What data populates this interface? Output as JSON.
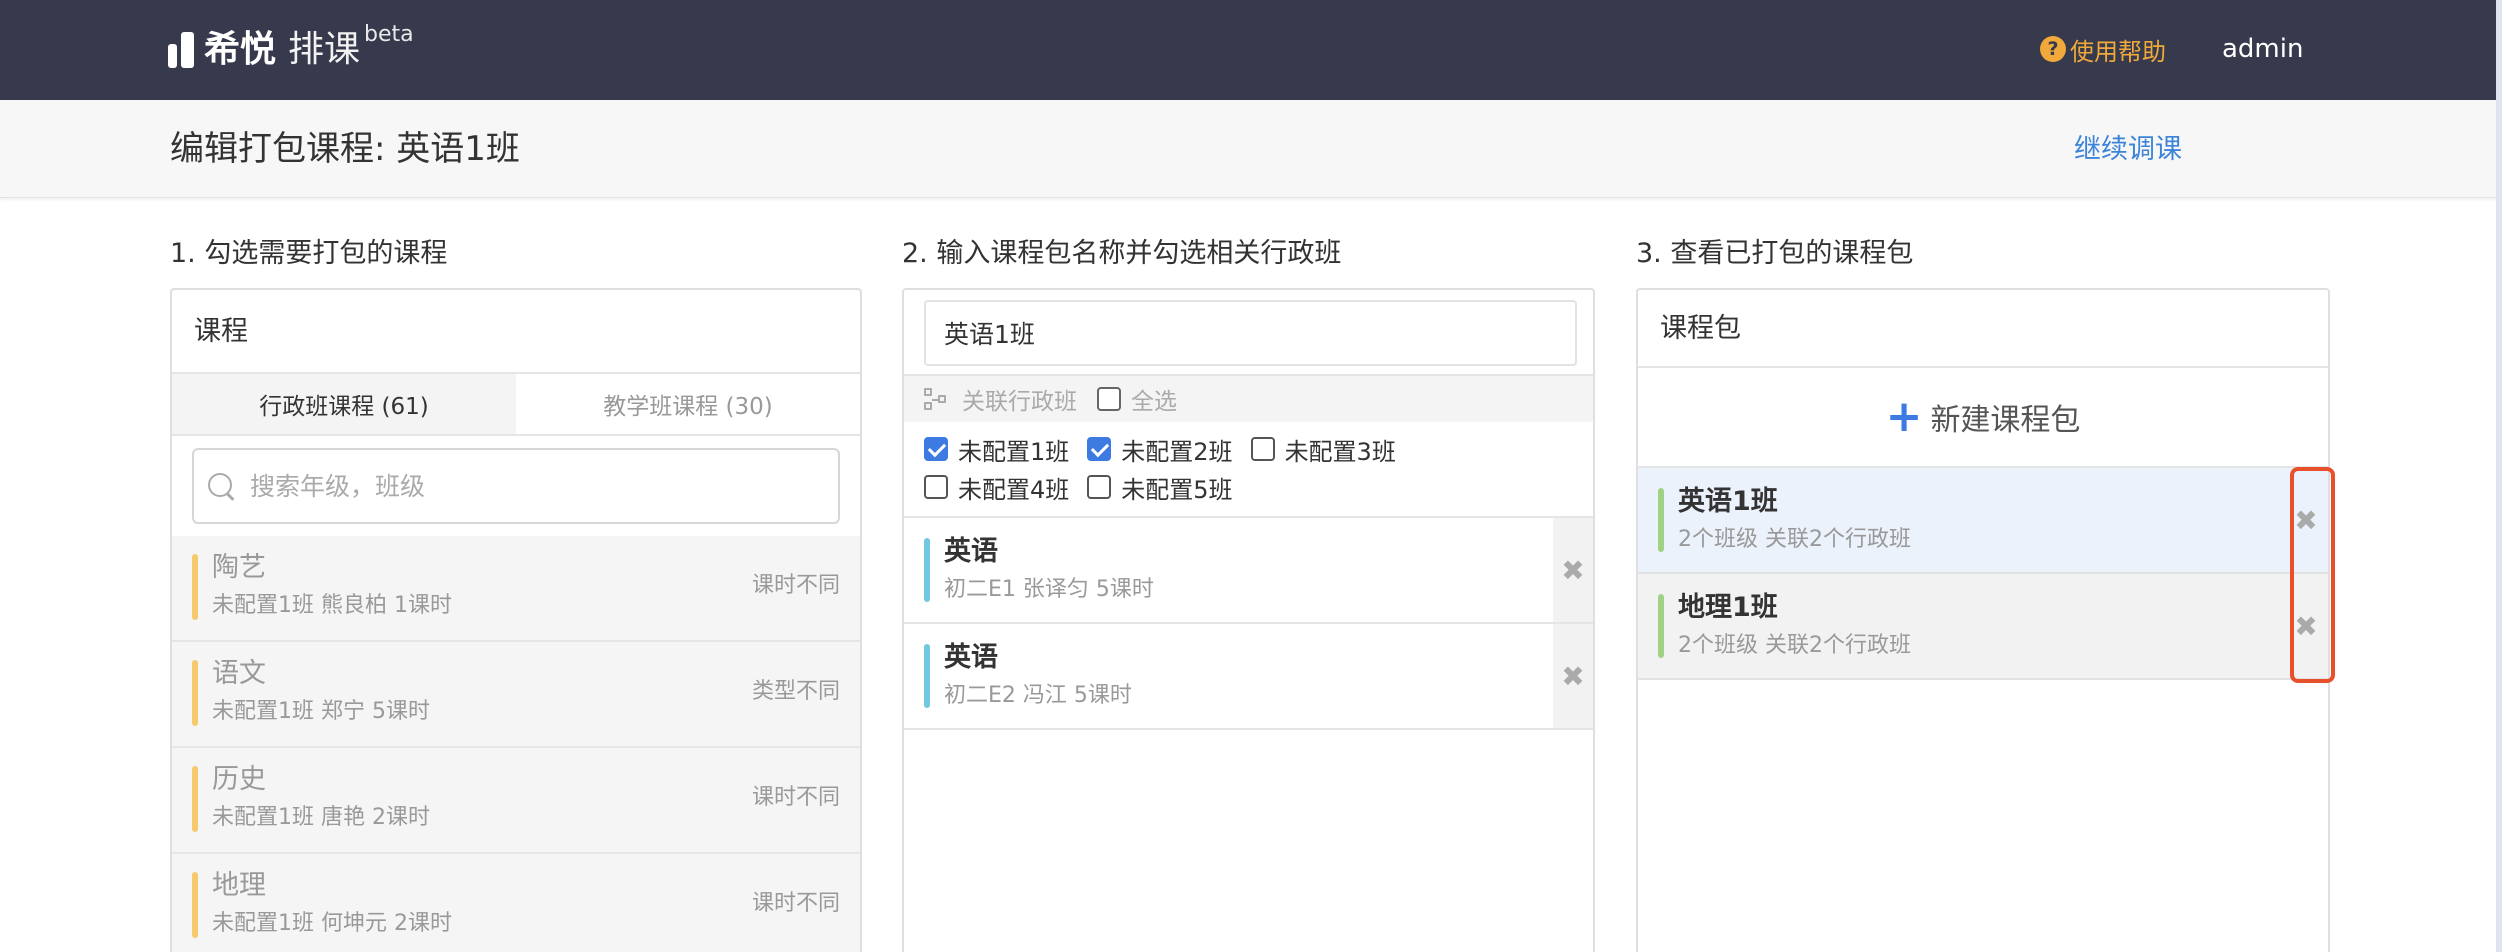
{
  "navbar": {
    "brand_name": "希悦",
    "brand_product": "排课",
    "brand_tag": "beta",
    "help_label": "使用帮助",
    "help_icon": "question-circle-icon",
    "user": "admin"
  },
  "header": {
    "title": "编辑打包课程: 英语1班",
    "continue_link": "继续调课"
  },
  "step1": {
    "title": "1. 勾选需要打包的课程",
    "panel_title": "课程",
    "tabs": [
      {
        "label": "行政班课程 (61)",
        "active": true
      },
      {
        "label": "教学班课程 (30)",
        "active": false
      }
    ],
    "search_placeholder": "搜索年级，班级",
    "courses": [
      {
        "name": "陶艺",
        "detail": "未配置1班 熊良柏 1课时",
        "note": "课时不同"
      },
      {
        "name": "语文",
        "detail": "未配置1班 郑宁 5课时",
        "note": "类型不同"
      },
      {
        "name": "历史",
        "detail": "未配置1班 唐艳 2课时",
        "note": "课时不同"
      },
      {
        "name": "地理",
        "detail": "未配置1班 何坤元 2课时",
        "note": "课时不同"
      }
    ]
  },
  "step2": {
    "title": "2. 输入课程包名称并勾选相关行政班",
    "package_name": "英语1班",
    "link_label": "关联行政班",
    "select_all": "全选",
    "classes": [
      {
        "label": "未配置1班",
        "checked": true
      },
      {
        "label": "未配置2班",
        "checked": true
      },
      {
        "label": "未配置3班",
        "checked": false
      },
      {
        "label": "未配置4班",
        "checked": false
      },
      {
        "label": "未配置5班",
        "checked": false
      }
    ],
    "selected": [
      {
        "name": "英语",
        "detail": "初二E1 张译匀 5课时"
      },
      {
        "name": "英语",
        "detail": "初二E2 冯江 5课时"
      }
    ],
    "remove_glyph": "✖"
  },
  "step3": {
    "title": "3. 查看已打包的课程包",
    "panel_title": "课程包",
    "new_label": "新建课程包",
    "packages": [
      {
        "name": "英语1班",
        "detail": "2个班级 关联2个行政班"
      },
      {
        "name": "地理1班",
        "detail": "2个班级 关联2个行政班"
      }
    ],
    "remove_glyph": "✖"
  }
}
